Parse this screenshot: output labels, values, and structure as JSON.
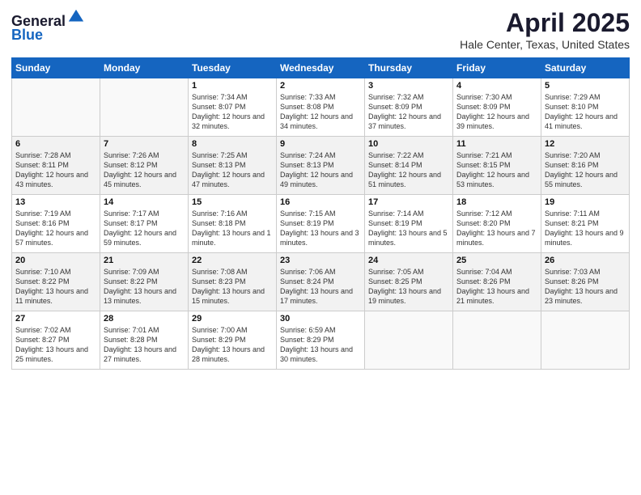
{
  "header": {
    "logo_line1": "General",
    "logo_line2": "Blue",
    "title": "April 2025",
    "subtitle": "Hale Center, Texas, United States"
  },
  "days_of_week": [
    "Sunday",
    "Monday",
    "Tuesday",
    "Wednesday",
    "Thursday",
    "Friday",
    "Saturday"
  ],
  "weeks": [
    [
      {
        "day": "",
        "info": ""
      },
      {
        "day": "",
        "info": ""
      },
      {
        "day": "1",
        "info": "Sunrise: 7:34 AM\nSunset: 8:07 PM\nDaylight: 12 hours and 32 minutes."
      },
      {
        "day": "2",
        "info": "Sunrise: 7:33 AM\nSunset: 8:08 PM\nDaylight: 12 hours and 34 minutes."
      },
      {
        "day": "3",
        "info": "Sunrise: 7:32 AM\nSunset: 8:09 PM\nDaylight: 12 hours and 37 minutes."
      },
      {
        "day": "4",
        "info": "Sunrise: 7:30 AM\nSunset: 8:09 PM\nDaylight: 12 hours and 39 minutes."
      },
      {
        "day": "5",
        "info": "Sunrise: 7:29 AM\nSunset: 8:10 PM\nDaylight: 12 hours and 41 minutes."
      }
    ],
    [
      {
        "day": "6",
        "info": "Sunrise: 7:28 AM\nSunset: 8:11 PM\nDaylight: 12 hours and 43 minutes."
      },
      {
        "day": "7",
        "info": "Sunrise: 7:26 AM\nSunset: 8:12 PM\nDaylight: 12 hours and 45 minutes."
      },
      {
        "day": "8",
        "info": "Sunrise: 7:25 AM\nSunset: 8:13 PM\nDaylight: 12 hours and 47 minutes."
      },
      {
        "day": "9",
        "info": "Sunrise: 7:24 AM\nSunset: 8:13 PM\nDaylight: 12 hours and 49 minutes."
      },
      {
        "day": "10",
        "info": "Sunrise: 7:22 AM\nSunset: 8:14 PM\nDaylight: 12 hours and 51 minutes."
      },
      {
        "day": "11",
        "info": "Sunrise: 7:21 AM\nSunset: 8:15 PM\nDaylight: 12 hours and 53 minutes."
      },
      {
        "day": "12",
        "info": "Sunrise: 7:20 AM\nSunset: 8:16 PM\nDaylight: 12 hours and 55 minutes."
      }
    ],
    [
      {
        "day": "13",
        "info": "Sunrise: 7:19 AM\nSunset: 8:16 PM\nDaylight: 12 hours and 57 minutes."
      },
      {
        "day": "14",
        "info": "Sunrise: 7:17 AM\nSunset: 8:17 PM\nDaylight: 12 hours and 59 minutes."
      },
      {
        "day": "15",
        "info": "Sunrise: 7:16 AM\nSunset: 8:18 PM\nDaylight: 13 hours and 1 minute."
      },
      {
        "day": "16",
        "info": "Sunrise: 7:15 AM\nSunset: 8:19 PM\nDaylight: 13 hours and 3 minutes."
      },
      {
        "day": "17",
        "info": "Sunrise: 7:14 AM\nSunset: 8:19 PM\nDaylight: 13 hours and 5 minutes."
      },
      {
        "day": "18",
        "info": "Sunrise: 7:12 AM\nSunset: 8:20 PM\nDaylight: 13 hours and 7 minutes."
      },
      {
        "day": "19",
        "info": "Sunrise: 7:11 AM\nSunset: 8:21 PM\nDaylight: 13 hours and 9 minutes."
      }
    ],
    [
      {
        "day": "20",
        "info": "Sunrise: 7:10 AM\nSunset: 8:22 PM\nDaylight: 13 hours and 11 minutes."
      },
      {
        "day": "21",
        "info": "Sunrise: 7:09 AM\nSunset: 8:22 PM\nDaylight: 13 hours and 13 minutes."
      },
      {
        "day": "22",
        "info": "Sunrise: 7:08 AM\nSunset: 8:23 PM\nDaylight: 13 hours and 15 minutes."
      },
      {
        "day": "23",
        "info": "Sunrise: 7:06 AM\nSunset: 8:24 PM\nDaylight: 13 hours and 17 minutes."
      },
      {
        "day": "24",
        "info": "Sunrise: 7:05 AM\nSunset: 8:25 PM\nDaylight: 13 hours and 19 minutes."
      },
      {
        "day": "25",
        "info": "Sunrise: 7:04 AM\nSunset: 8:26 PM\nDaylight: 13 hours and 21 minutes."
      },
      {
        "day": "26",
        "info": "Sunrise: 7:03 AM\nSunset: 8:26 PM\nDaylight: 13 hours and 23 minutes."
      }
    ],
    [
      {
        "day": "27",
        "info": "Sunrise: 7:02 AM\nSunset: 8:27 PM\nDaylight: 13 hours and 25 minutes."
      },
      {
        "day": "28",
        "info": "Sunrise: 7:01 AM\nSunset: 8:28 PM\nDaylight: 13 hours and 27 minutes."
      },
      {
        "day": "29",
        "info": "Sunrise: 7:00 AM\nSunset: 8:29 PM\nDaylight: 13 hours and 28 minutes."
      },
      {
        "day": "30",
        "info": "Sunrise: 6:59 AM\nSunset: 8:29 PM\nDaylight: 13 hours and 30 minutes."
      },
      {
        "day": "",
        "info": ""
      },
      {
        "day": "",
        "info": ""
      },
      {
        "day": "",
        "info": ""
      }
    ]
  ]
}
